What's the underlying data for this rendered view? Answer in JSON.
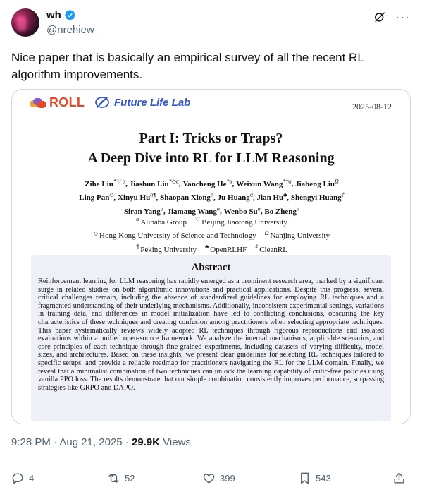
{
  "author": {
    "display_name": "wh",
    "handle": "@nrehiew_"
  },
  "tweet": {
    "text": "Nice paper that is basically an empirical survey of all the recent RL algorithm improvements."
  },
  "paper": {
    "logo_roll": "ROLL",
    "logo_lab": "Future Life Lab",
    "date": "2025-08-12",
    "title_line1": "Part I: Tricks or Traps?",
    "title_line2": "A Deep Dive into RL for LLM Reasoning",
    "authors_line1": [
      {
        "name": "Zihe Liu",
        "sup": "*♡ α"
      },
      {
        "name": "Jiashun Liu",
        "sup": "*◇α"
      },
      {
        "name": "Yancheng He",
        "sup": "*α"
      },
      {
        "name": "Weixun Wang",
        "sup": "*†α"
      },
      {
        "name": "Jiaheng Liu",
        "sup": "Ω"
      }
    ],
    "authors_line2": [
      {
        "name": "Ling Pan",
        "sup": "◇"
      },
      {
        "name": "Xinyu Hu",
        "sup": "α¶"
      },
      {
        "name": "Shaopan Xiong",
        "sup": "α"
      },
      {
        "name": "Ju Huang",
        "sup": "α"
      },
      {
        "name": "Jian Hu",
        "sup": "♣"
      },
      {
        "name": "Shengyi Huang",
        "sup": "‡"
      }
    ],
    "authors_line3": [
      {
        "name": "Siran Yang",
        "sup": "α"
      },
      {
        "name": "Jiamang Wang",
        "sup": "α"
      },
      {
        "name": "Wenbo Su",
        "sup": "α"
      },
      {
        "name": "Bo Zheng",
        "sup": "α"
      }
    ],
    "affiliations": [
      [
        {
          "sym": "α",
          "text": "Alibaba Group"
        },
        {
          "sym": "♡",
          "text": "Beijing Jiaotong University"
        }
      ],
      [
        {
          "sym": "◇",
          "text": "Hong Kong University of Science and Technology"
        },
        {
          "sym": "Ω",
          "text": "Nanjing University"
        }
      ],
      [
        {
          "sym": "¶",
          "text": "Peking University"
        },
        {
          "sym": "♣",
          "text": "OpenRLHF"
        },
        {
          "sym": "‡",
          "text": "CleanRL"
        }
      ]
    ],
    "abstract_title": "Abstract",
    "abstract_text": "Reinforcement learning for LLM reasoning has rapidly emerged as a prominent research area, marked by a significant surge in related studies on both algorithmic innovations and practical applications. Despite this progress, several critical challenges remain, including the absence of standardized guidelines for employing RL techniques and a fragmented understanding of their underlying mechanisms. Additionally, inconsistent experimental settings, variations in training data, and differences in model initialization have led to conflicting conclusions, obscuring the key characteristics of these techniques and creating confusion among practitioners when selecting appropriate techniques. This paper systematically reviews widely adopted RL techniques through rigorous reproductions and isolated evaluations within a unified open-source framework. We analyze the internal mechanisms, applicable scenarios, and core principles of each technique through fine-grained experiments, including datasets of varying difficulty, model sizes, and architectures. Based on these insights, we present clear guidelines for selecting RL techniques tailored to specific setups, and provide a reliable roadmap for practitioners navigating the RL for the LLM domain. Finally, we reveal that a minimalist combination of two techniques can unlock the learning capability of critic-free policies using vanilla PPO loss. The results demonstrate that our simple combination consistently improves performance, surpassing strategies like GRPO and DAPO."
  },
  "meta": {
    "time": "9:28 PM",
    "separator": "·",
    "date": "Aug 21, 2025",
    "views_count": "29.9K",
    "views_label": "Views"
  },
  "actions": {
    "replies": "4",
    "reposts": "52",
    "likes": "399",
    "bookmarks": "543"
  },
  "colors": {
    "verified": "#1d9bf0",
    "roll": "#e04a2b",
    "lab": "#3556c9",
    "muted": "#536471"
  }
}
